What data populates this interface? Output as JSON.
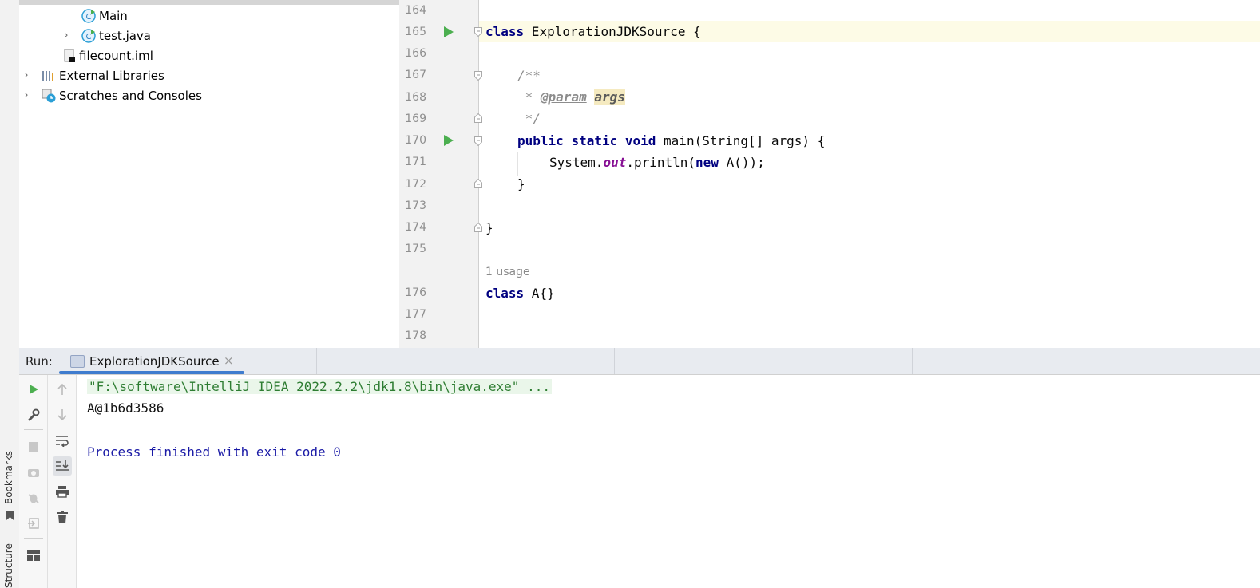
{
  "sidebar_strip": {
    "bookmarks_label": "Bookmarks",
    "structure_label": "Structure"
  },
  "project_tree": {
    "items": [
      {
        "label": "Main",
        "icon": "java-class-icon"
      },
      {
        "label": "test.java",
        "icon": "java-class-icon"
      },
      {
        "label": "filecount.iml",
        "icon": "iml-file-icon"
      },
      {
        "label": "External Libraries",
        "icon": "libraries-icon"
      },
      {
        "label": "Scratches and Consoles",
        "icon": "scratches-icon"
      }
    ]
  },
  "editor": {
    "line_numbers": [
      "164",
      "165",
      "166",
      "167",
      "168",
      "169",
      "170",
      "171",
      "172",
      "173",
      "174",
      "175",
      "176",
      "177",
      "178"
    ],
    "usage_hint": "1 usage",
    "code": {
      "l165_kw": "class",
      "l165_rest": " ExplorationJDKSource {",
      "l167": "/**",
      "l168_prefix": " * ",
      "l168_tag": "@param",
      "l168_arg": "args",
      "l169": " */",
      "l170_kw1": "public",
      "l170_kw2": "static",
      "l170_kw3": "void",
      "l170_rest": " main(String[] args) {",
      "l171_a": "System.",
      "l171_field": "out",
      "l171_b": ".println(",
      "l171_kw": "new",
      "l171_c": " A());",
      "l172": "}",
      "l174": "}",
      "l176_kw": "class",
      "l176_rest": " A{}"
    }
  },
  "run_panel": {
    "label": "Run:",
    "tab_title": "ExplorationJDKSource",
    "tab_close": "×",
    "console": {
      "command": "\"F:\\software\\IntelliJ IDEA 2022.2.2\\jdk1.8\\bin\\java.exe\" ...",
      "output": "A@1b6d3586",
      "exit_message": "Process finished with exit code 0"
    }
  },
  "colors": {
    "run_green": "#4caf50",
    "keyword_blue": "#000080",
    "exit_text": "#1a1aa6",
    "tab_underline": "#3f7cce"
  }
}
